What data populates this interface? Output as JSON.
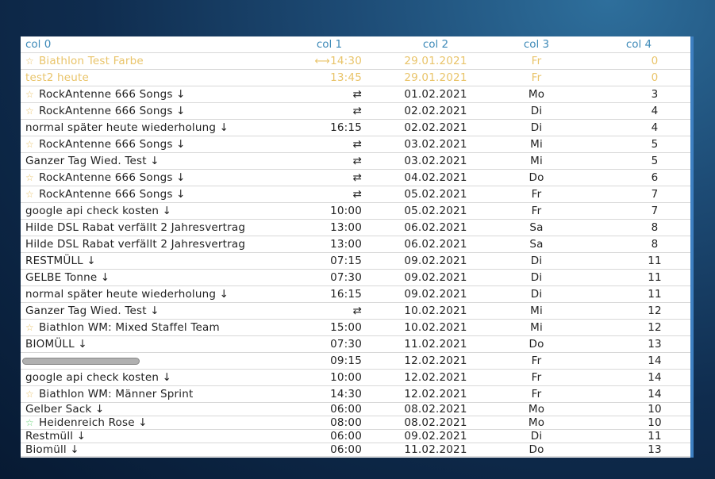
{
  "columns": [
    "col 0",
    "col 1",
    "col 2",
    "col 3",
    "col 4"
  ],
  "colors": {
    "highlight_text": "#e9c46a",
    "header_text": "#3e8ab8",
    "star_yellow": "#e9c46a",
    "star_green": "#6bd67b",
    "panel_border": "#3d7fc1"
  },
  "rows": [
    {
      "title": "Biathlon Test Farbe",
      "time": "⟷14:30",
      "date": "29.01.2021",
      "day": "Fr",
      "count": "0"
    },
    {
      "title": "test2 heute",
      "time": "13:45",
      "date": "29.01.2021",
      "day": "Fr",
      "count": "0"
    },
    {
      "title": "RockAntenne 666 Songs ↓",
      "time": "⇄",
      "date": "01.02.2021",
      "day": "Mo",
      "count": "3"
    },
    {
      "title": "RockAntenne 666 Songs ↓",
      "time": "⇄",
      "date": "02.02.2021",
      "day": "Di",
      "count": "4"
    },
    {
      "title": "normal später heute wiederholung ↓",
      "time": "16:15",
      "date": "02.02.2021",
      "day": "Di",
      "count": "4"
    },
    {
      "title": "RockAntenne 666 Songs ↓",
      "time": "⇄",
      "date": "03.02.2021",
      "day": "Mi",
      "count": "5"
    },
    {
      "title": "Ganzer Tag Wied. Test ↓",
      "time": "⇄",
      "date": "03.02.2021",
      "day": "Mi",
      "count": "5"
    },
    {
      "title": "RockAntenne 666 Songs ↓",
      "time": "⇄",
      "date": "04.02.2021",
      "day": "Do",
      "count": "6"
    },
    {
      "title": "RockAntenne 666 Songs ↓",
      "time": "⇄",
      "date": "05.02.2021",
      "day": "Fr",
      "count": "7"
    },
    {
      "title": "google api check kosten ↓",
      "time": "10:00",
      "date": "05.02.2021",
      "day": "Fr",
      "count": "7"
    },
    {
      "title": "Hilde DSL Rabat verfällt 2 Jahresvertrag",
      "time": "13:00",
      "date": "06.02.2021",
      "day": "Sa",
      "count": "8"
    },
    {
      "title": "Hilde DSL Rabat verfällt 2 Jahresvertrag",
      "time": "13:00",
      "date": "06.02.2021",
      "day": "Sa",
      "count": "8"
    },
    {
      "title": "RESTMÜLL ↓",
      "time": "07:15",
      "date": "09.02.2021",
      "day": "Di",
      "count": "11"
    },
    {
      "title": "GELBE Tonne ↓",
      "time": "07:30",
      "date": "09.02.2021",
      "day": "Di",
      "count": "11"
    },
    {
      "title": "normal später heute wiederholung ↓",
      "time": "16:15",
      "date": "09.02.2021",
      "day": "Di",
      "count": "11"
    },
    {
      "title": "Ganzer Tag Wied. Test ↓",
      "time": "⇄",
      "date": "10.02.2021",
      "day": "Mi",
      "count": "12"
    },
    {
      "title": "Biathlon WM: Mixed Staffel Team",
      "time": "15:00",
      "date": "10.02.2021",
      "day": "Mi",
      "count": "12"
    },
    {
      "title": "BIOMÜLL ↓",
      "time": "07:30",
      "date": "11.02.2021",
      "day": "Do",
      "count": "13"
    },
    {
      "title": "",
      "time": "09:15",
      "date": "12.02.2021",
      "day": "Fr",
      "count": "14"
    },
    {
      "title": "google api check kosten ↓",
      "time": "10:00",
      "date": "12.02.2021",
      "day": "Fr",
      "count": "14"
    },
    {
      "title": "Biathlon WM: Männer Sprint",
      "time": "14:30",
      "date": "12.02.2021",
      "day": "Fr",
      "count": "14"
    },
    {
      "title": "Gelber Sack ↓",
      "time": "06:00",
      "date": "08.02.2021",
      "day": "Mo",
      "count": "10"
    },
    {
      "title": "Heidenreich Rose ↓",
      "time": "08:00",
      "date": "08.02.2021",
      "day": "Mo",
      "count": "10"
    },
    {
      "title": "Restmüll ↓",
      "time": "06:00",
      "date": "09.02.2021",
      "day": "Di",
      "count": "11"
    },
    {
      "title": "Biomüll ↓",
      "time": "06:00",
      "date": "11.02.2021",
      "day": "Do",
      "count": "13"
    }
  ]
}
